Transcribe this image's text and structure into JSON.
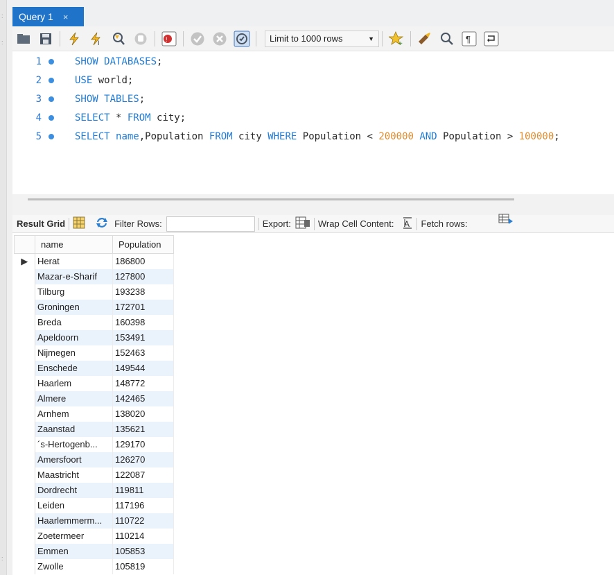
{
  "tabs": [
    {
      "label": "Query 1",
      "close": "×"
    }
  ],
  "toolbar": {
    "icons": [
      "open-file-icon",
      "save-icon",
      "execute-icon",
      "execute-current-icon",
      "explain-icon",
      "stop-icon",
      "toggle-error-stop-icon",
      "commit-icon",
      "rollback-icon",
      "autocommit-icon"
    ],
    "limit_label": "Limit to 1000 rows",
    "icons_right": [
      "bookmark-icon",
      "beautify-icon",
      "find-icon",
      "invisible-chars-icon",
      "wrap-icon"
    ]
  },
  "editor": {
    "lines": [
      {
        "n": "1",
        "tokens": [
          {
            "t": "SHOW DATABASES",
            "c": "kw"
          },
          {
            "t": ";",
            "c": "code"
          }
        ]
      },
      {
        "n": "2",
        "tokens": [
          {
            "t": "USE",
            "c": "kw"
          },
          {
            "t": " world;",
            "c": "code"
          }
        ]
      },
      {
        "n": "3",
        "tokens": [
          {
            "t": "SHOW TABLES",
            "c": "kw"
          },
          {
            "t": ";",
            "c": "code"
          }
        ]
      },
      {
        "n": "4",
        "tokens": [
          {
            "t": "SELECT",
            "c": "kw"
          },
          {
            "t": " * ",
            "c": "code"
          },
          {
            "t": "FROM",
            "c": "kw"
          },
          {
            "t": " city;",
            "c": "code"
          }
        ]
      },
      {
        "n": "5",
        "tokens": [
          {
            "t": "SELECT",
            "c": "kw"
          },
          {
            "t": " ",
            "c": "code"
          },
          {
            "t": "name",
            "c": "kw"
          },
          {
            "t": ",Population ",
            "c": "code"
          },
          {
            "t": "FROM",
            "c": "kw"
          },
          {
            "t": " city ",
            "c": "code"
          },
          {
            "t": "WHERE",
            "c": "kw"
          },
          {
            "t": " Population < ",
            "c": "code"
          },
          {
            "t": "200000",
            "c": "num"
          },
          {
            "t": " ",
            "c": "code"
          },
          {
            "t": "AND",
            "c": "kw"
          },
          {
            "t": " Population > ",
            "c": "code"
          },
          {
            "t": "100000",
            "c": "num"
          },
          {
            "t": ";",
            "c": "code"
          }
        ]
      }
    ]
  },
  "result_toolbar": {
    "result_grid": "Result Grid",
    "filter_rows": "Filter Rows:",
    "export": "Export:",
    "wrap_cell": "Wrap Cell Content:",
    "fetch_rows": "Fetch rows:"
  },
  "grid": {
    "columns": [
      "name",
      "Population"
    ],
    "rows": [
      [
        "Herat",
        "186800"
      ],
      [
        "Mazar-e-Sharif",
        "127800"
      ],
      [
        "Tilburg",
        "193238"
      ],
      [
        "Groningen",
        "172701"
      ],
      [
        "Breda",
        "160398"
      ],
      [
        "Apeldoorn",
        "153491"
      ],
      [
        "Nijmegen",
        "152463"
      ],
      [
        "Enschede",
        "149544"
      ],
      [
        "Haarlem",
        "148772"
      ],
      [
        "Almere",
        "142465"
      ],
      [
        "Arnhem",
        "138020"
      ],
      [
        "Zaanstad",
        "135621"
      ],
      [
        "´s-Hertogenb...",
        "129170"
      ],
      [
        "Amersfoort",
        "126270"
      ],
      [
        "Maastricht",
        "122087"
      ],
      [
        "Dordrecht",
        "119811"
      ],
      [
        "Leiden",
        "117196"
      ],
      [
        "Haarlemmerm...",
        "110722"
      ],
      [
        "Zoetermeer",
        "110214"
      ],
      [
        "Emmen",
        "105853"
      ],
      [
        "Zwolle",
        "105819"
      ]
    ],
    "selected_marker": "▶"
  }
}
